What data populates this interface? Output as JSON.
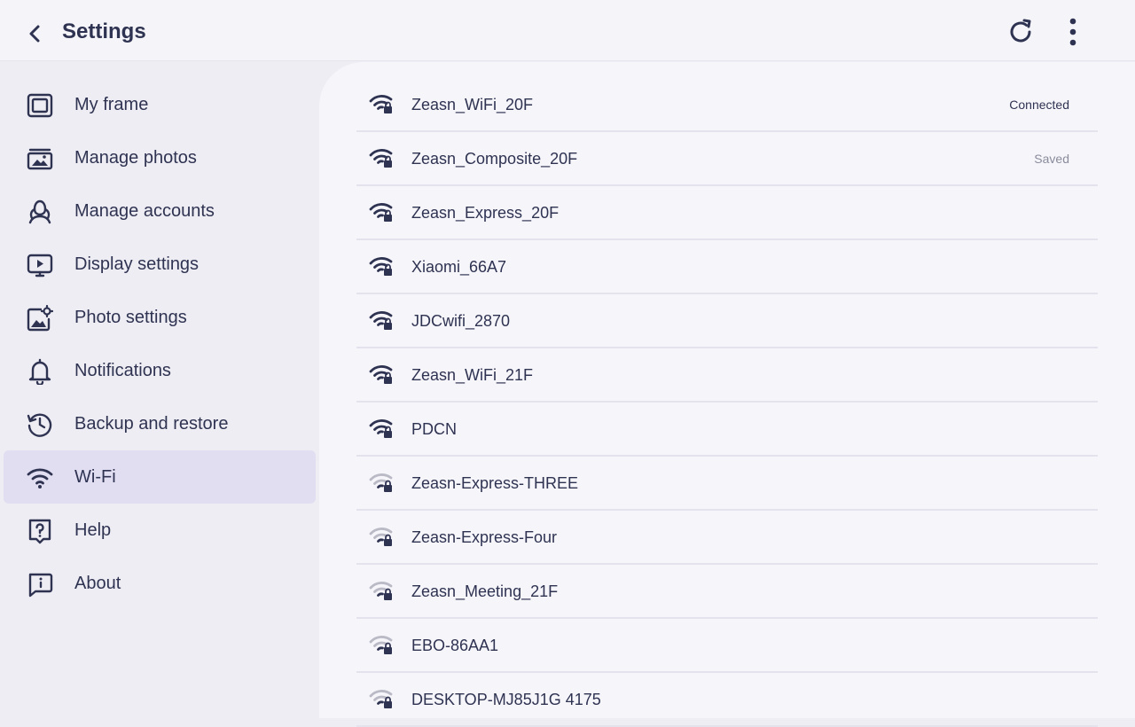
{
  "header": {
    "title": "Settings"
  },
  "colors": {
    "accent": "#2f3352",
    "active_bg": "#e1def2",
    "weak_signal": "#b9bac5"
  },
  "sidebar": {
    "items": [
      {
        "label": "My frame",
        "icon": "frame-icon"
      },
      {
        "label": "Manage photos",
        "icon": "photos-icon"
      },
      {
        "label": "Manage accounts",
        "icon": "accounts-icon"
      },
      {
        "label": "Display settings",
        "icon": "display-icon"
      },
      {
        "label": "Photo settings",
        "icon": "photo-settings-icon"
      },
      {
        "label": "Notifications",
        "icon": "bell-icon"
      },
      {
        "label": "Backup and restore",
        "icon": "backup-icon"
      },
      {
        "label": "Wi-Fi",
        "icon": "wifi-icon",
        "active": true
      },
      {
        "label": "Help",
        "icon": "help-icon"
      },
      {
        "label": "About",
        "icon": "about-icon"
      }
    ]
  },
  "wifi": {
    "networks": [
      {
        "name": "Zeasn_WiFi_20F",
        "status": "Connected",
        "signal": "strong"
      },
      {
        "name": "Zeasn_Composite_20F",
        "status": "Saved",
        "signal": "strong"
      },
      {
        "name": "Zeasn_Express_20F",
        "status": "",
        "signal": "strong"
      },
      {
        "name": "Xiaomi_66A7",
        "status": "",
        "signal": "strong"
      },
      {
        "name": "JDCwifi_2870",
        "status": "",
        "signal": "strong"
      },
      {
        "name": "Zeasn_WiFi_21F",
        "status": "",
        "signal": "strong"
      },
      {
        "name": "PDCN",
        "status": "",
        "signal": "strong"
      },
      {
        "name": "Zeasn-Express-THREE",
        "status": "",
        "signal": "weak"
      },
      {
        "name": "Zeasn-Express-Four",
        "status": "",
        "signal": "weak"
      },
      {
        "name": "Zeasn_Meeting_21F",
        "status": "",
        "signal": "weak"
      },
      {
        "name": "EBO-86AA1",
        "status": "",
        "signal": "weak"
      },
      {
        "name": "DESKTOP-MJ85J1G 4175",
        "status": "",
        "signal": "weak"
      }
    ]
  }
}
